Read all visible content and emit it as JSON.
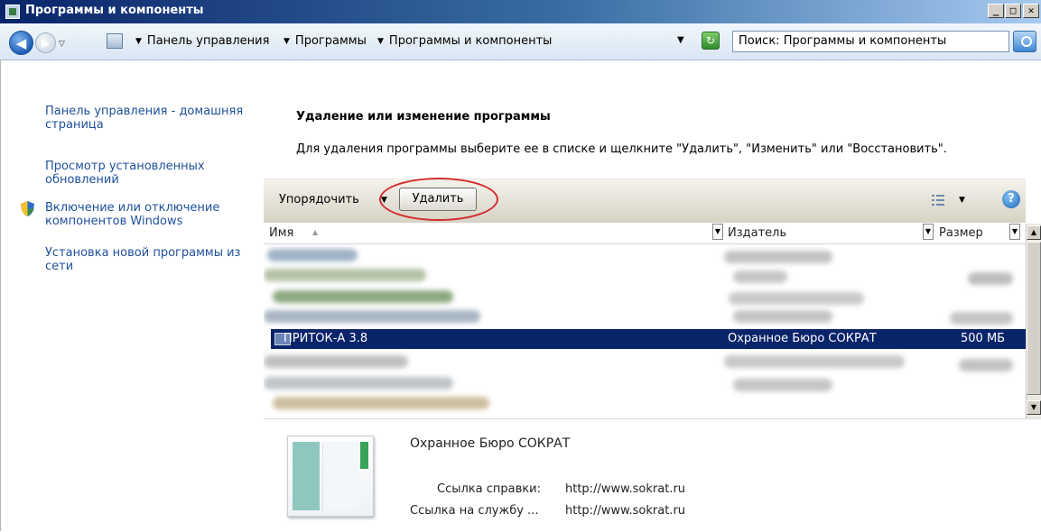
{
  "window": {
    "title": "Программы и компоненты",
    "controls": {
      "minimize": "_",
      "maximize": "□",
      "close": "✕"
    }
  },
  "address_bar": {
    "breadcrumbs": [
      "Панель управления",
      "Программы",
      "Программы и компоненты"
    ],
    "search_placeholder": "Поиск: Программы и компоненты"
  },
  "left_pane": {
    "links": [
      "Панель управления - домашняя страница",
      "Просмотр установленных обновлений",
      "Включение или отключение компонентов Windows",
      "Установка новой программы из сети"
    ]
  },
  "main": {
    "heading": "Удаление или изменение программы",
    "instruction": "Для удаления программы выберите ее в списке и щелкните \"Удалить\", \"Изменить\" или \"Восстановить\".",
    "toolbar": {
      "organize_label": "Упорядочить",
      "delete_label": "Удалить",
      "help_label": "?",
      "highlight_color": "#d12b2b"
    },
    "columns": {
      "name": "Имя",
      "publisher": "Издатель",
      "size": "Размер"
    },
    "selected_program": {
      "name": "ПРИТОК-А 3.8",
      "publisher": "Охранное Бюро СОКРАТ",
      "size": "500 МБ"
    },
    "selection_color": "#0a246a"
  },
  "details": {
    "publisher": "Охранное Бюро СОКРАТ",
    "help_link_label": "Ссылка справки:",
    "help_link_value": "http://www.sokrat.ru",
    "support_link_label": "Ссылка на службу ...",
    "support_link_value": "http://www.sokrat.ru"
  }
}
